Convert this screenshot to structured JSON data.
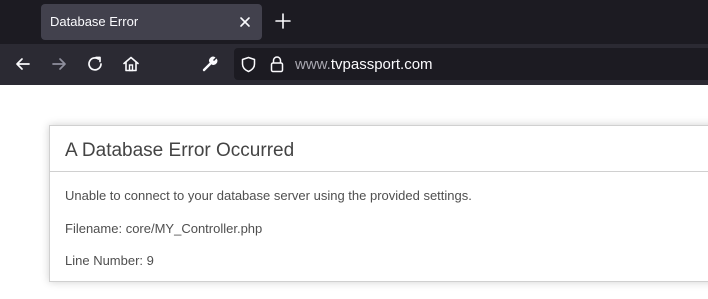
{
  "browser": {
    "tab": {
      "title": "Database Error"
    },
    "url": {
      "prefix": "www.",
      "domain": "tvpassport.com"
    },
    "icons": [
      "back-arrow-icon",
      "forward-arrow-icon",
      "reload-icon",
      "home-icon",
      "wrench-icon",
      "shield-icon",
      "lock-icon",
      "close-icon",
      "plus-icon"
    ],
    "colors": {
      "tabbar_bg": "#1c1b22",
      "navbar_bg": "#2b2a33",
      "active_tab_bg": "#42414d",
      "text_light": "#fbfbfe"
    }
  },
  "page": {
    "heading": "A Database Error Occurred",
    "lines": [
      "Unable to connect to your database server using the provided settings.",
      "Filename: core/MY_Controller.php",
      "Line Number: 9"
    ],
    "colors": {
      "heading": "#444444",
      "text": "#4f4f4f",
      "border": "#d0d0d0"
    }
  }
}
